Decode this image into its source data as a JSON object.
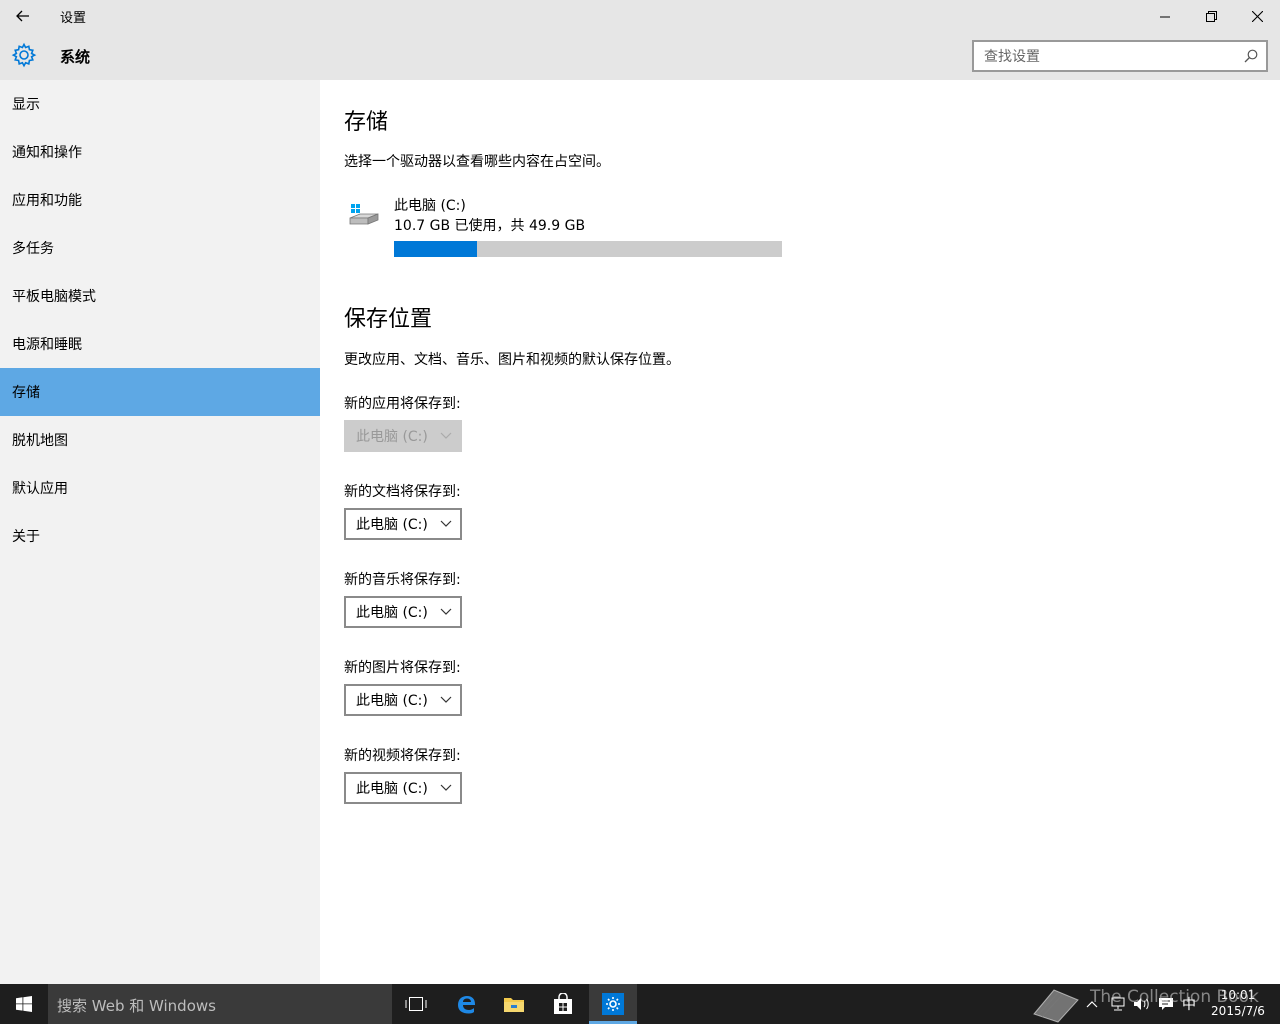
{
  "window": {
    "title": "设置",
    "back_icon": "back-arrow-icon",
    "minimize_icon": "minimize-icon",
    "maximize_icon": "restore-icon",
    "close_icon": "close-icon"
  },
  "header": {
    "icon": "gear-icon",
    "title": "系统",
    "search_placeholder": "查找设置",
    "search_icon": "search-icon"
  },
  "sidebar": {
    "items": [
      {
        "label": "显示",
        "active": false
      },
      {
        "label": "通知和操作",
        "active": false
      },
      {
        "label": "应用和功能",
        "active": false
      },
      {
        "label": "多任务",
        "active": false
      },
      {
        "label": "平板电脑模式",
        "active": false
      },
      {
        "label": "电源和睡眠",
        "active": false
      },
      {
        "label": "存储",
        "active": true
      },
      {
        "label": "脱机地图",
        "active": false
      },
      {
        "label": "默认应用",
        "active": false
      },
      {
        "label": "关于",
        "active": false
      }
    ],
    "active_color": "#5ea8e4"
  },
  "storage": {
    "title": "存储",
    "description": "选择一个驱动器以查看哪些内容在占空间。",
    "drive": {
      "name": "此电脑 (C:)",
      "usage_text": "10.7 GB 已使用，共 49.9 GB",
      "used_fraction": 0.214,
      "bar_color": "#0078d7"
    }
  },
  "save_locations": {
    "title": "保存位置",
    "description": "更改应用、文档、音乐、图片和视频的默认保存位置。",
    "fields": [
      {
        "label": "新的应用将保存到:",
        "value": "此电脑 (C:)",
        "disabled": true
      },
      {
        "label": "新的文档将保存到:",
        "value": "此电脑 (C:)",
        "disabled": false
      },
      {
        "label": "新的音乐将保存到:",
        "value": "此电脑 (C:)",
        "disabled": false
      },
      {
        "label": "新的图片将保存到:",
        "value": "此电脑 (C:)",
        "disabled": false
      },
      {
        "label": "新的视频将保存到:",
        "value": "此电脑 (C:)",
        "disabled": false
      }
    ]
  },
  "taskbar": {
    "search_text": "搜索 Web 和 Windows",
    "time": "10:01",
    "date": "2015/7/6",
    "ime": "中",
    "watermark": "The Collection Book"
  }
}
